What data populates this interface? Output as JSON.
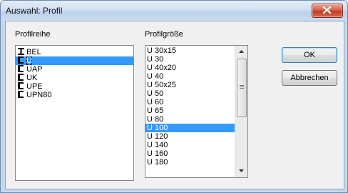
{
  "window": {
    "title": "Auswahl: Profil",
    "close_icon": "close-x-icon"
  },
  "profilreihe": {
    "label": "Profilreihe",
    "selected": "U",
    "items": [
      {
        "label": "BEL",
        "icon": "i-beam-icon"
      },
      {
        "label": "U",
        "icon": "u-channel-icon"
      },
      {
        "label": "UAP",
        "icon": "u-channel-icon"
      },
      {
        "label": "UK",
        "icon": "u-channel-icon"
      },
      {
        "label": "UPE",
        "icon": "u-channel-icon"
      },
      {
        "label": "UPN80",
        "icon": "u-channel-icon"
      }
    ]
  },
  "profilgroesse": {
    "label": "Profilgröße",
    "selected": "U 100",
    "items": [
      "U 30x15",
      "U 30",
      "U 40x20",
      "U 40",
      "U 50x25",
      "U 50",
      "U 60",
      "U 65",
      "U 80",
      "U 100",
      "U 120",
      "U 140",
      "U 160",
      "U 180"
    ]
  },
  "buttons": {
    "ok": "OK",
    "cancel": "Abbrechen"
  },
  "colors": {
    "selection": "#3399ff",
    "close_button": "#c23a21",
    "titlebar": "#c6d7ec"
  }
}
